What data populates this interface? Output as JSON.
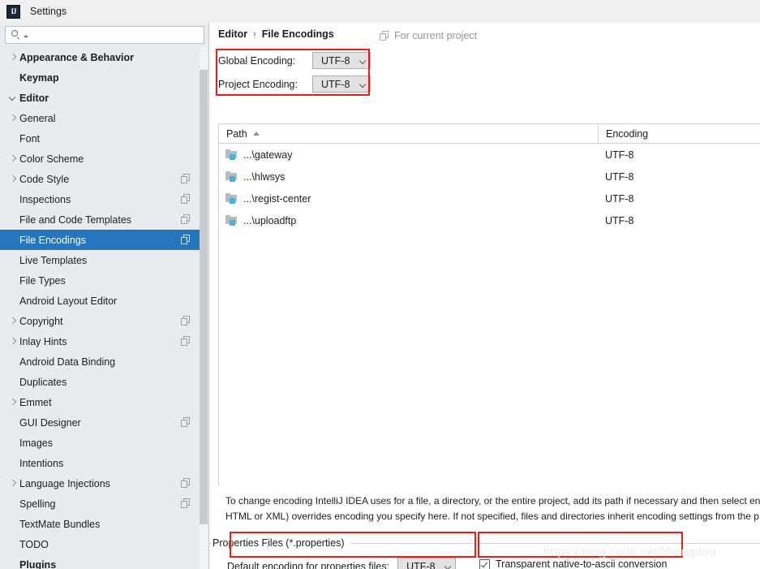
{
  "window": {
    "title": "Settings",
    "logo_text": "IJ",
    "logo_icon": "intellij-idea-icon"
  },
  "search": {
    "value": "",
    "placeholder": "",
    "icon": "search-icon",
    "caret_icon": "chevron-down-icon"
  },
  "sidebar": {
    "items": [
      {
        "label": "Appearance & Behavior",
        "indent": 0,
        "twisty": "right",
        "bold": true,
        "copy": false,
        "selected": false
      },
      {
        "label": "Keymap",
        "indent": 0,
        "twisty": "none",
        "bold": true,
        "copy": false,
        "selected": false
      },
      {
        "label": "Editor",
        "indent": 0,
        "twisty": "down",
        "bold": true,
        "copy": false,
        "selected": false
      },
      {
        "label": "General",
        "indent": 1,
        "twisty": "right",
        "bold": false,
        "copy": false,
        "selected": false
      },
      {
        "label": "Font",
        "indent": 1,
        "twisty": "none",
        "bold": false,
        "copy": false,
        "selected": false
      },
      {
        "label": "Color Scheme",
        "indent": 1,
        "twisty": "right",
        "bold": false,
        "copy": false,
        "selected": false
      },
      {
        "label": "Code Style",
        "indent": 1,
        "twisty": "right",
        "bold": false,
        "copy": true,
        "selected": false
      },
      {
        "label": "Inspections",
        "indent": 1,
        "twisty": "none",
        "bold": false,
        "copy": true,
        "selected": false
      },
      {
        "label": "File and Code Templates",
        "indent": 1,
        "twisty": "none",
        "bold": false,
        "copy": true,
        "selected": false
      },
      {
        "label": "File Encodings",
        "indent": 1,
        "twisty": "none",
        "bold": false,
        "copy": true,
        "selected": true
      },
      {
        "label": "Live Templates",
        "indent": 1,
        "twisty": "none",
        "bold": false,
        "copy": false,
        "selected": false
      },
      {
        "label": "File Types",
        "indent": 1,
        "twisty": "none",
        "bold": false,
        "copy": false,
        "selected": false
      },
      {
        "label": "Android Layout Editor",
        "indent": 1,
        "twisty": "none",
        "bold": false,
        "copy": false,
        "selected": false
      },
      {
        "label": "Copyright",
        "indent": 1,
        "twisty": "right",
        "bold": false,
        "copy": true,
        "selected": false
      },
      {
        "label": "Inlay Hints",
        "indent": 1,
        "twisty": "right",
        "bold": false,
        "copy": true,
        "selected": false
      },
      {
        "label": "Android Data Binding",
        "indent": 1,
        "twisty": "none",
        "bold": false,
        "copy": false,
        "selected": false
      },
      {
        "label": "Duplicates",
        "indent": 1,
        "twisty": "none",
        "bold": false,
        "copy": false,
        "selected": false
      },
      {
        "label": "Emmet",
        "indent": 1,
        "twisty": "right",
        "bold": false,
        "copy": false,
        "selected": false
      },
      {
        "label": "GUI Designer",
        "indent": 1,
        "twisty": "none",
        "bold": false,
        "copy": true,
        "selected": false
      },
      {
        "label": "Images",
        "indent": 1,
        "twisty": "none",
        "bold": false,
        "copy": false,
        "selected": false
      },
      {
        "label": "Intentions",
        "indent": 1,
        "twisty": "none",
        "bold": false,
        "copy": false,
        "selected": false
      },
      {
        "label": "Language Injections",
        "indent": 1,
        "twisty": "right",
        "bold": false,
        "copy": true,
        "selected": false
      },
      {
        "label": "Spelling",
        "indent": 1,
        "twisty": "none",
        "bold": false,
        "copy": true,
        "selected": false
      },
      {
        "label": "TextMate Bundles",
        "indent": 1,
        "twisty": "none",
        "bold": false,
        "copy": false,
        "selected": false
      },
      {
        "label": "TODO",
        "indent": 1,
        "twisty": "none",
        "bold": false,
        "copy": false,
        "selected": false
      },
      {
        "label": "Plugins",
        "indent": 0,
        "twisty": "none",
        "bold": true,
        "copy": false,
        "selected": false
      }
    ]
  },
  "main": {
    "breadcrumb": {
      "root": "Editor",
      "separator": "›",
      "leaf": "File Encodings"
    },
    "for_current_project": {
      "label": "For current project",
      "icon": "copy-icon"
    },
    "global_encoding": {
      "label": "Global Encoding:",
      "value": "UTF-8"
    },
    "project_encoding": {
      "label": "Project Encoding:",
      "value": "UTF-8"
    },
    "table": {
      "columns": [
        "Path",
        "Encoding"
      ],
      "sort_column": "Path",
      "sort_direction": "ascending",
      "rows": [
        {
          "path": "...\\gateway",
          "encoding": "UTF-8",
          "icon": "module-folder-icon"
        },
        {
          "path": "...\\hlwsys",
          "encoding": "UTF-8",
          "icon": "module-folder-icon"
        },
        {
          "path": "...\\regist-center",
          "encoding": "UTF-8",
          "icon": "module-folder-icon"
        },
        {
          "path": "...\\uploadftp",
          "encoding": "UTF-8",
          "icon": "module-folder-icon"
        }
      ]
    },
    "description_line1": "To change encoding IntelliJ IDEA uses for a file, a directory, or the entire project, add its path if necessary and then select enc",
    "description_line2": "HTML or XML) overrides encoding you specify here. If not specified, files and directories inherit encoding settings from the p",
    "properties_group": {
      "title": "Properties Files (*.properties)",
      "default_encoding_label": "Default encoding for properties files:",
      "default_encoding_value": "UTF-8",
      "transparent_checkbox_label": "Transparent native-to-ascii conversion",
      "transparent_checkbox_checked": true
    }
  },
  "annotations": {
    "accent_color": "#f01c12",
    "watermark": "https://blog.csdn.net/lihongdou"
  }
}
